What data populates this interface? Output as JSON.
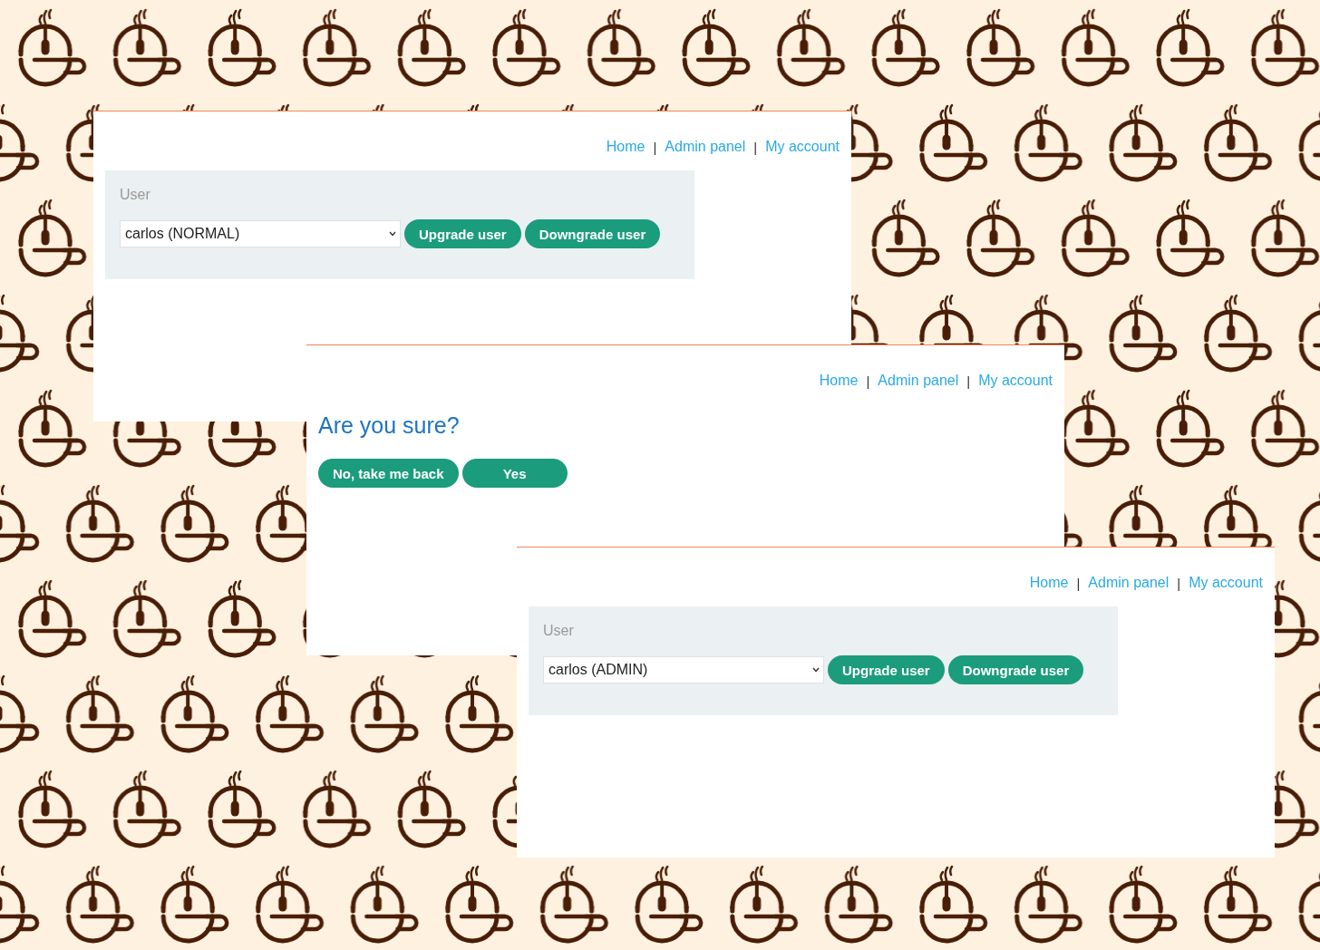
{
  "panels": [
    {
      "kind": "user_form",
      "nav": {
        "links": [
          "Home",
          "Admin panel",
          "My account"
        ],
        "separator": "|"
      },
      "field_label": "User",
      "select_value": "carlos (NORMAL)",
      "buttons": [
        "Upgrade user",
        "Downgrade user"
      ]
    },
    {
      "kind": "confirm",
      "nav": {
        "links": [
          "Home",
          "Admin panel",
          "My account"
        ],
        "separator": "|"
      },
      "heading": "Are you sure?",
      "buttons": [
        "No, take me back",
        "Yes"
      ]
    },
    {
      "kind": "user_form",
      "nav": {
        "links": [
          "Home",
          "Admin panel",
          "My account"
        ],
        "separator": "|"
      },
      "field_label": "User",
      "select_value": "carlos (ADMIN)",
      "buttons": [
        "Upgrade user",
        "Downgrade user"
      ]
    }
  ]
}
